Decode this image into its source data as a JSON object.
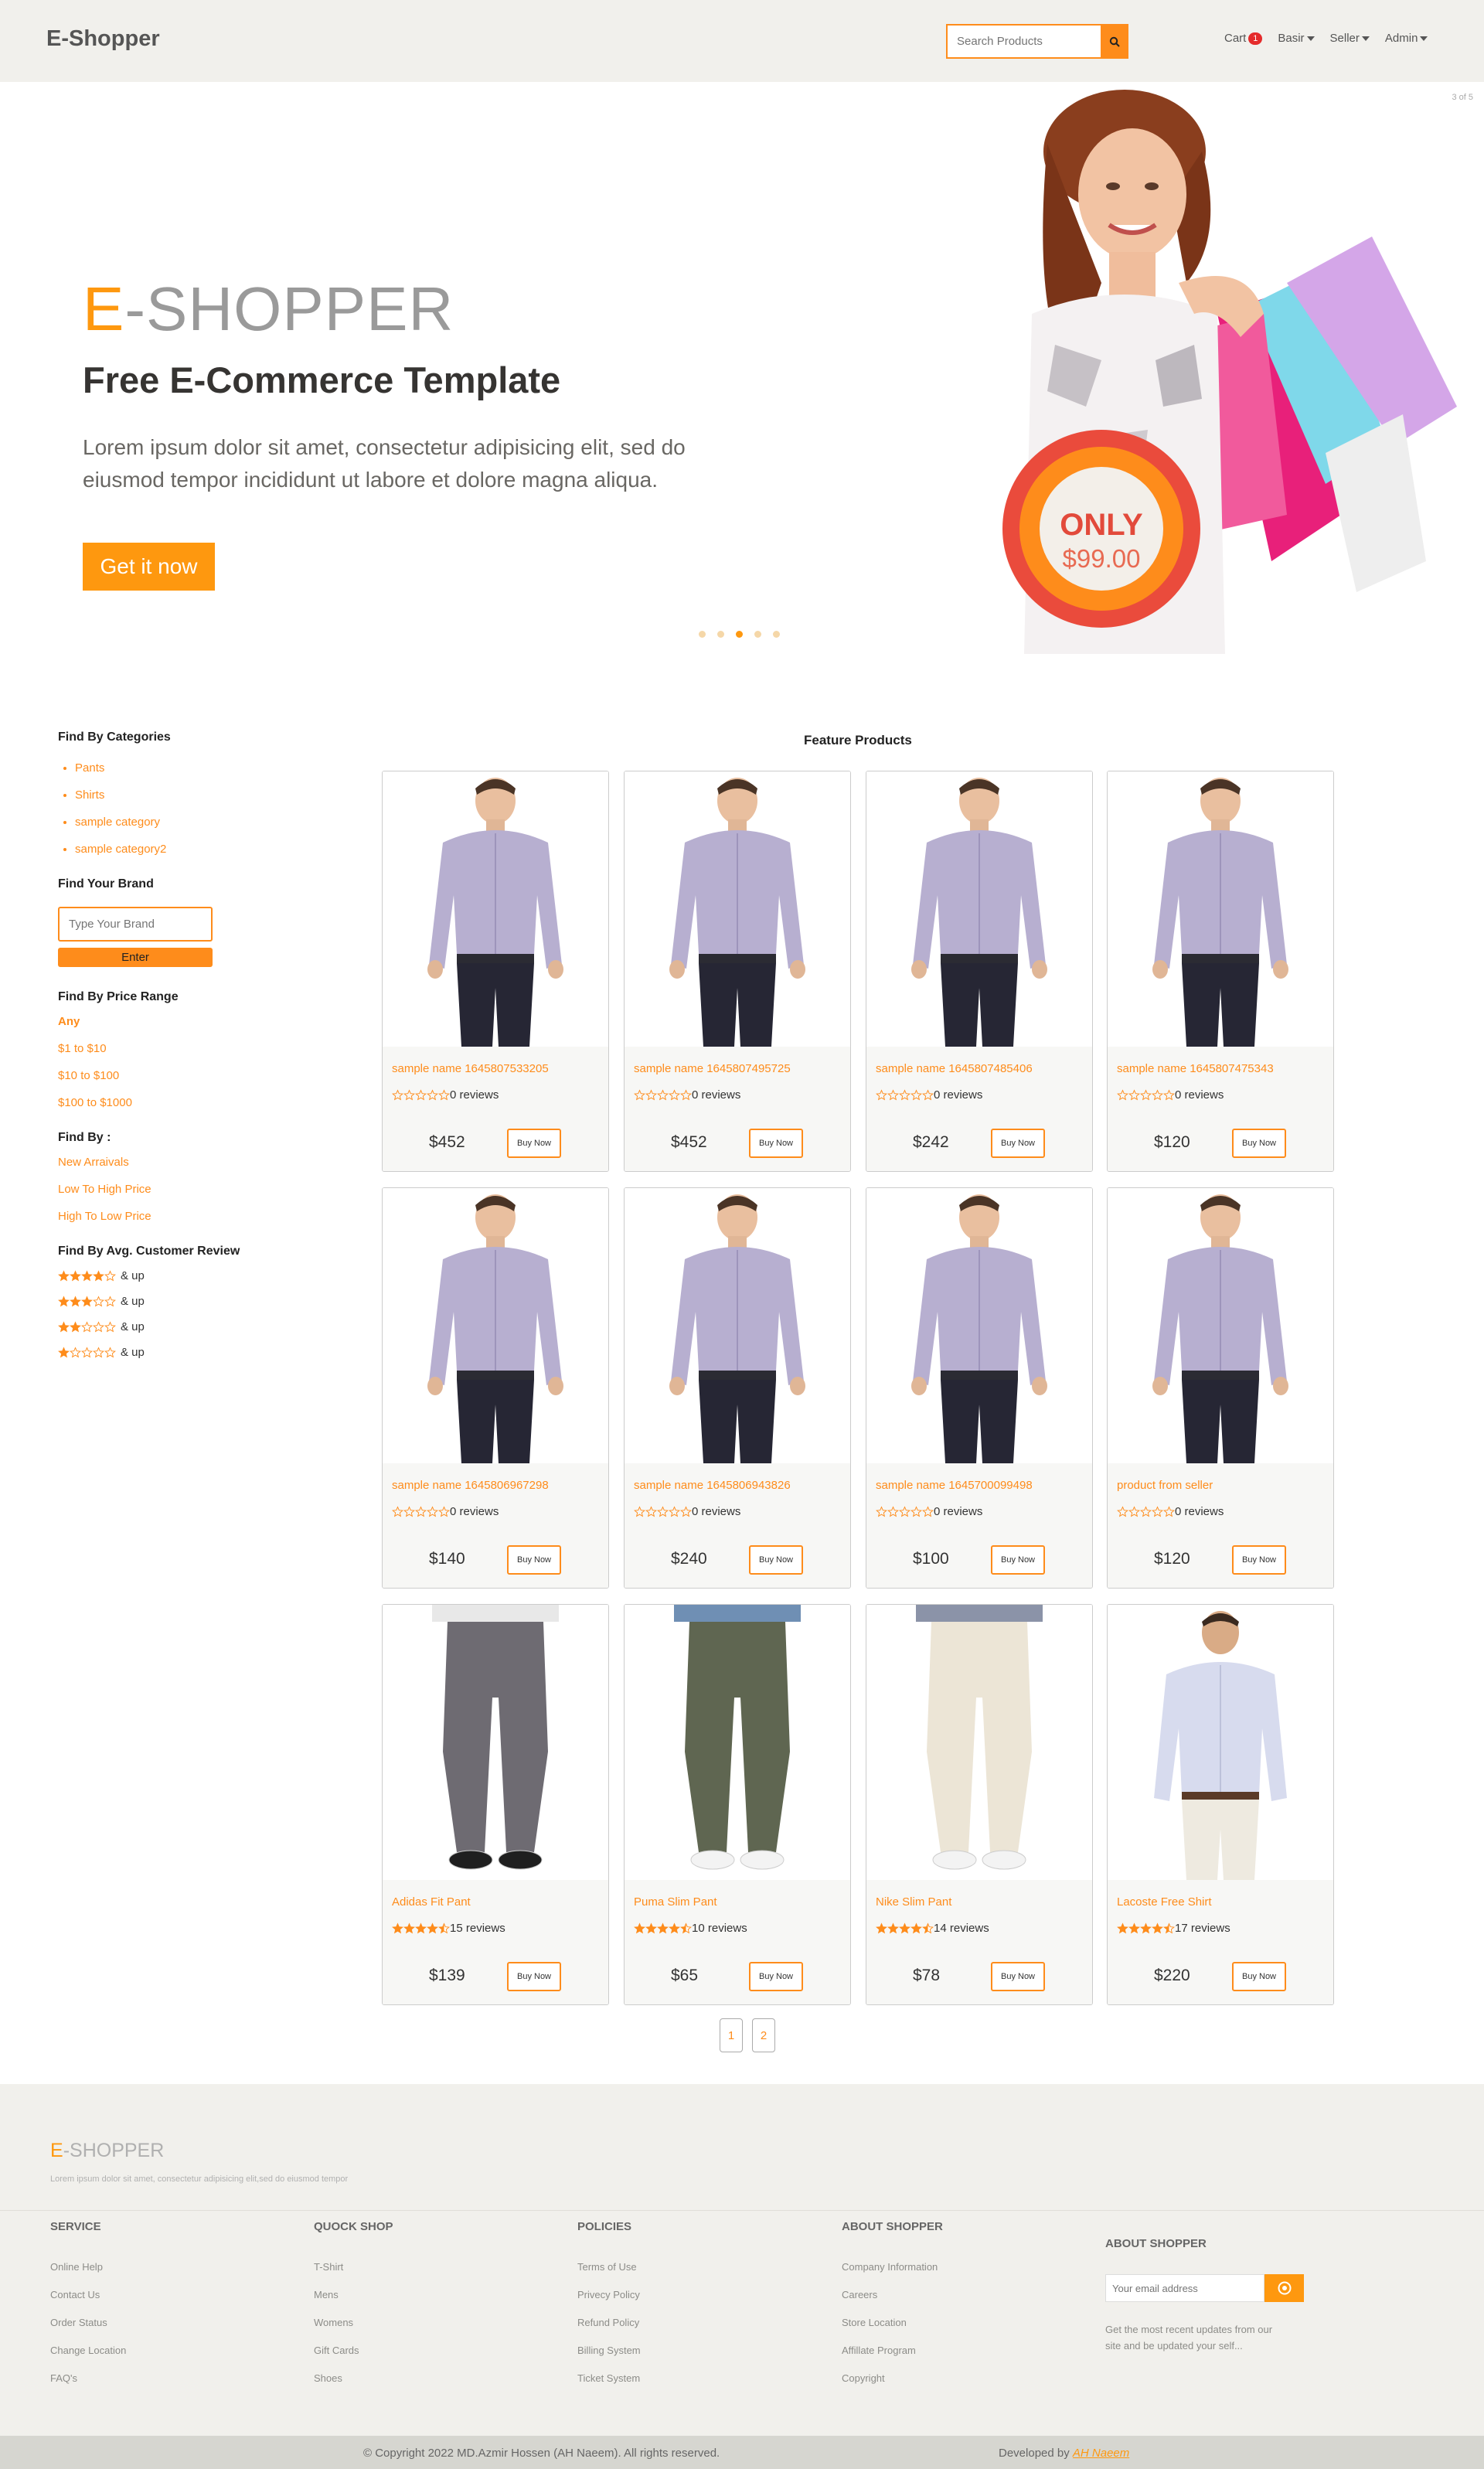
{
  "header": {
    "logo": "E-Shopper",
    "search_placeholder": "Search Products",
    "nav": {
      "cart": "Cart",
      "cart_count": "1",
      "basir": "Basir",
      "seller": "Seller",
      "admin": "Admin"
    }
  },
  "hero": {
    "counter": "3 of 5",
    "brand_accent": "E",
    "brand_rest": "-SHOPPER",
    "title": "Free E-Commerce Template",
    "text": "Lorem ipsum dolor sit amet, consectetur adipisicing elit, sed do eiusmod tempor incididunt ut labore et dolore magna aliqua.",
    "button": "Get it now",
    "badge_only": "ONLY",
    "badge_price": "$99.00",
    "slides_total": 5,
    "active_slide": 3
  },
  "sidebar": {
    "categories_title": "Find By Categories",
    "categories": [
      "Pants",
      "Shirts",
      "sample category",
      "sample category2"
    ],
    "brand_title": "Find Your Brand",
    "brand_placeholder": "Type Your Brand",
    "brand_button": "Enter",
    "price_title": "Find By Price Range",
    "price_ranges": [
      "Any",
      "$1 to $10",
      "$10 to $100",
      "$100 to $1000"
    ],
    "sort_title": "Find By :",
    "sort_options": [
      "New Arraivals",
      "Low To High Price",
      "High To Low Price"
    ],
    "review_title": "Find By Avg. Customer Review",
    "review_suffix": "& up",
    "review_levels": [
      4,
      3,
      2,
      1
    ]
  },
  "products": {
    "title": "Feature Products",
    "buy_label": "Buy Now",
    "items": [
      {
        "name": "sample name 1645807533205",
        "rating": 0,
        "reviews": "0 reviews",
        "price": "$452",
        "image": "shirt"
      },
      {
        "name": "sample name 1645807495725",
        "rating": 0,
        "reviews": "0 reviews",
        "price": "$452",
        "image": "shirt"
      },
      {
        "name": "sample name 1645807485406",
        "rating": 0,
        "reviews": "0 reviews",
        "price": "$242",
        "image": "shirt"
      },
      {
        "name": "sample name 1645807475343",
        "rating": 0,
        "reviews": "0 reviews",
        "price": "$120",
        "image": "shirt"
      },
      {
        "name": "sample name 1645806967298",
        "rating": 0,
        "reviews": "0 reviews",
        "price": "$140",
        "image": "shirt"
      },
      {
        "name": "sample name 1645806943826",
        "rating": 0,
        "reviews": "0 reviews",
        "price": "$240",
        "image": "shirt"
      },
      {
        "name": "sample name 1645700099498",
        "rating": 0,
        "reviews": "0 reviews",
        "price": "$100",
        "image": "shirt"
      },
      {
        "name": "product from seller",
        "rating": 0,
        "reviews": "0 reviews",
        "price": "$120",
        "image": "shirt"
      },
      {
        "name": "Adidas Fit Pant",
        "rating": 4.5,
        "reviews": "15 reviews",
        "price": "$139",
        "image": "pant-grey"
      },
      {
        "name": "Puma Slim Pant",
        "rating": 4.5,
        "reviews": "10 reviews",
        "price": "$65",
        "image": "pant-olive"
      },
      {
        "name": "Nike Slim Pant",
        "rating": 4.5,
        "reviews": "14 reviews",
        "price": "$78",
        "image": "pant-cream"
      },
      {
        "name": "Lacoste Free Shirt",
        "rating": 4.5,
        "reviews": "17 reviews",
        "price": "$220",
        "image": "lacoste"
      }
    ],
    "pages": [
      "1",
      "2"
    ]
  },
  "footer": {
    "brand_accent": "E",
    "brand_rest": "-SHOPPER",
    "tagline": "Lorem ipsum dolor sit amet, consectetur adipisicing elit,sed do eiusmod tempor",
    "columns": [
      {
        "title": "SERVICE",
        "links": [
          "Online Help",
          "Contact Us",
          "Order Status",
          "Change Location",
          "FAQ's"
        ]
      },
      {
        "title": "QUOCK SHOP",
        "links": [
          "T-Shirt",
          "Mens",
          "Womens",
          "Gift Cards",
          "Shoes"
        ]
      },
      {
        "title": "POLICIES",
        "links": [
          "Terms of Use",
          "Privecy Policy",
          "Refund Policy",
          "Billing System",
          "Ticket System"
        ]
      },
      {
        "title": "ABOUT SHOPPER",
        "links": [
          "Company Information",
          "Careers",
          "Store Location",
          "Affillate Program",
          "Copyright"
        ]
      }
    ],
    "subscribe_title": "ABOUT SHOPPER",
    "subscribe_placeholder": "Your email address",
    "subscribe_text": "Get the most recent updates from our site and be updated your self...",
    "copyright": "© Copyright 2022 MD.Azmir Hossen (AH Naeem). All rights reserved.",
    "developed_by": "Developed by",
    "developer": "AH Naeem"
  },
  "colors": {
    "accent": "#fe980f",
    "accent_dark": "#fe8c1b",
    "header_bg": "#f1f0ec",
    "footer_bg": "#f1f0ec"
  }
}
